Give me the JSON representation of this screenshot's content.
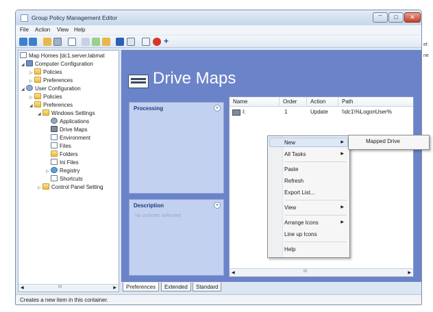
{
  "window": {
    "title": "Group Policy Management Editor",
    "controls": {
      "minimize": "–",
      "maximize": "□",
      "close": "✕"
    }
  },
  "menubar": [
    "File",
    "Action",
    "View",
    "Help"
  ],
  "tree": {
    "root": "Map Homes [dc1.server.labmat",
    "computer_config": "Computer Configuration",
    "cc_policies": "Policies",
    "cc_preferences": "Preferences",
    "user_config": "User Configuration",
    "uc_policies": "Policies",
    "uc_preferences": "Preferences",
    "windows_settings": "Windows Settings",
    "applications": "Applications",
    "drive_maps": "Drive Maps",
    "environment": "Environment",
    "files": "Files",
    "folders": "Folders",
    "ini_files": "Ini Files",
    "registry": "Registry",
    "shortcuts": "Shortcuts",
    "control_panel": "Control Panel Setting",
    "scroll_label": "III"
  },
  "content": {
    "title": "Drive Maps",
    "processing": {
      "title": "Processing",
      "chevron": "»"
    },
    "description": {
      "title": "Description",
      "chevron": "»",
      "text": "No policies selected"
    }
  },
  "list": {
    "columns": [
      "Name",
      "Order",
      "Action",
      "Path"
    ],
    "rows": [
      {
        "name": "I:",
        "order": "1",
        "action": "Update",
        "path": "\\\\dc1\\%LogonUser%"
      }
    ],
    "scroll_label": "III"
  },
  "context_menu": {
    "items": {
      "new": "New",
      "all_tasks": "All Tasks",
      "paste": "Paste",
      "refresh": "Refresh",
      "export": "Export List...",
      "view": "View",
      "arrange": "Arrange Icons",
      "lineup": "Line up Icons",
      "help": "Help"
    },
    "arrow": "▶"
  },
  "submenu": {
    "mapped_drive": "Mapped Drive"
  },
  "tabs": [
    "Preferences",
    "Extended",
    "Standard"
  ],
  "status": "Creates a new item in this container.",
  "offscreen": {
    "a": "el:",
    "b": "ne"
  }
}
